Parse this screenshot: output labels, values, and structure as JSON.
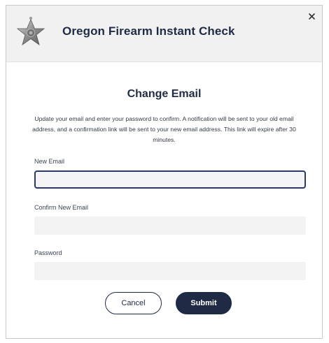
{
  "header": {
    "title": "Oregon Firearm Instant Check",
    "logo_icon": "sheriff-star-badge-icon",
    "close_icon": "close-icon"
  },
  "dialog": {
    "title": "Change Email",
    "description": "Update your email and enter your password to confirm. A notification will be sent to your old email address, and a confirmation link will be sent to your new email address. This link will expire after 30 minutes."
  },
  "form": {
    "new_email": {
      "label": "New Email",
      "value": ""
    },
    "confirm_email": {
      "label": "Confirm New Email",
      "value": ""
    },
    "password": {
      "label": "Password",
      "value": ""
    }
  },
  "buttons": {
    "cancel": "Cancel",
    "submit": "Submit"
  },
  "colors": {
    "primary": "#1f2a44",
    "header_bg": "#f1f1f1",
    "field_bg": "#f3f3f3"
  }
}
